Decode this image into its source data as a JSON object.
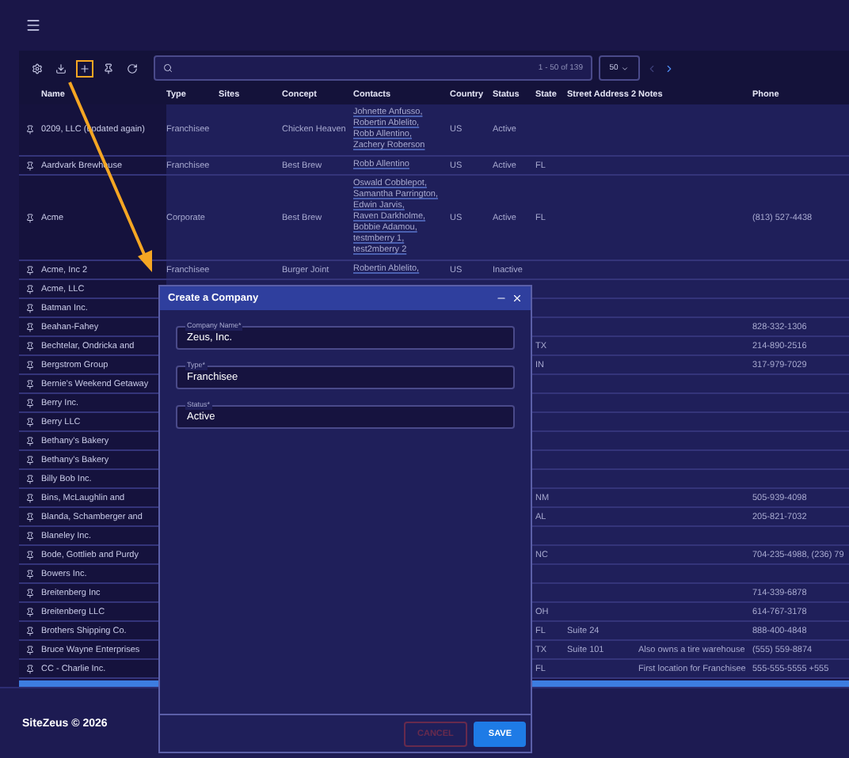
{
  "toolbar": {
    "search": {
      "range": "1 - 50 of 139"
    },
    "page_size": "50",
    "pager": {
      "previous_disabled": true,
      "next_disabled": false
    }
  },
  "table": {
    "columns": [
      "Name",
      "Type",
      "Sites",
      "Concept",
      "Contacts",
      "Country",
      "Status",
      "State",
      "Street Address 2",
      "Notes",
      "Phone"
    ],
    "rows": [
      {
        "name": "0209, LLC (updated again)",
        "type": "Franchisee",
        "concept": "Chicken Heaven",
        "contacts": [
          "Johnette Anfusso,",
          "Robertin Ablelito,",
          "Robb Allentino,",
          "Zachery Roberson"
        ],
        "country": "US",
        "status": "Active"
      },
      {
        "name": "Aardvark Brewhouse",
        "type": "Franchisee",
        "concept": "Best Brew",
        "contacts": [
          "Robb Allentino"
        ],
        "country": "US",
        "status": "Active",
        "state": "FL"
      },
      {
        "name": "Acme",
        "type": "Corporate",
        "concept": "Best Brew",
        "contacts": [
          "Oswald Cobblepot,",
          "Samantha Parrington,",
          "Edwin Jarvis,",
          "Raven Darkholme,",
          "Bobbie Adamou,",
          "testmberry 1,",
          "test2mberry 2"
        ],
        "country": "US",
        "status": "Active",
        "state": "FL",
        "phone": "(813) 527-4438"
      },
      {
        "name": "Acme, Inc 2",
        "type": "Franchisee",
        "concept": "Burger Joint",
        "contacts": [
          "Robertin Ablelito,"
        ],
        "country": "US",
        "status": "Inactive"
      },
      {
        "name": "Acme, LLC"
      },
      {
        "name": "Batman Inc."
      },
      {
        "name": "Beahan-Fahey",
        "phone": "828-332-1306"
      },
      {
        "name": "Bechtelar, Ondricka and",
        "state": "TX",
        "phone": "214-890-2516"
      },
      {
        "name": "Bergstrom Group",
        "state": "IN",
        "phone": "317-979-7029"
      },
      {
        "name": "Bernie's Weekend Getaway"
      },
      {
        "name": "Berry Inc."
      },
      {
        "name": "Berry LLC"
      },
      {
        "name": "Bethany's Bakery"
      },
      {
        "name": "Bethany's Bakery"
      },
      {
        "name": "Billy Bob Inc."
      },
      {
        "name": "Bins, McLaughlin and",
        "state": "NM",
        "phone": "505-939-4098"
      },
      {
        "name": "Blanda, Schamberger and",
        "state": "AL",
        "phone": "205-821-7032"
      },
      {
        "name": "Blaneley Inc."
      },
      {
        "name": "Bode, Gottlieb and Purdy",
        "state": "NC",
        "phone": "704-235-4988, (236) 79"
      },
      {
        "name": "Bowers Inc."
      },
      {
        "name": "Breitenberg Inc",
        "phone": "714-339-6878"
      },
      {
        "name": "Breitenberg LLC",
        "state": "OH",
        "phone": "614-767-3178"
      },
      {
        "name": "Brothers Shipping Co.",
        "state": "FL",
        "street": "Suite 24",
        "phone": "888-400-4848"
      },
      {
        "name": "Bruce Wayne Enterprises",
        "state": "TX",
        "street": "Suite 101",
        "notes": "Also owns a tire warehouse",
        "phone": "(555) 559-8874"
      },
      {
        "name": "CC - Charlie Inc.",
        "state": "FL",
        "notes": "First location for Franchisee",
        "phone": "555-555-5555 +555"
      }
    ]
  },
  "dialog": {
    "title": "Create a Company",
    "fields": [
      {
        "label": "Company Name*",
        "value": "Zeus, Inc."
      },
      {
        "label": "Type*",
        "value": "Franchisee"
      },
      {
        "label": "Status*",
        "value": "Active"
      }
    ],
    "buttons": [
      {
        "label": "CANCEL",
        "kind": "cancel",
        "disabled": true
      },
      {
        "label": "SAVE",
        "kind": "primary",
        "disabled": false
      }
    ]
  },
  "footer": "SiteZeus © 2026"
}
